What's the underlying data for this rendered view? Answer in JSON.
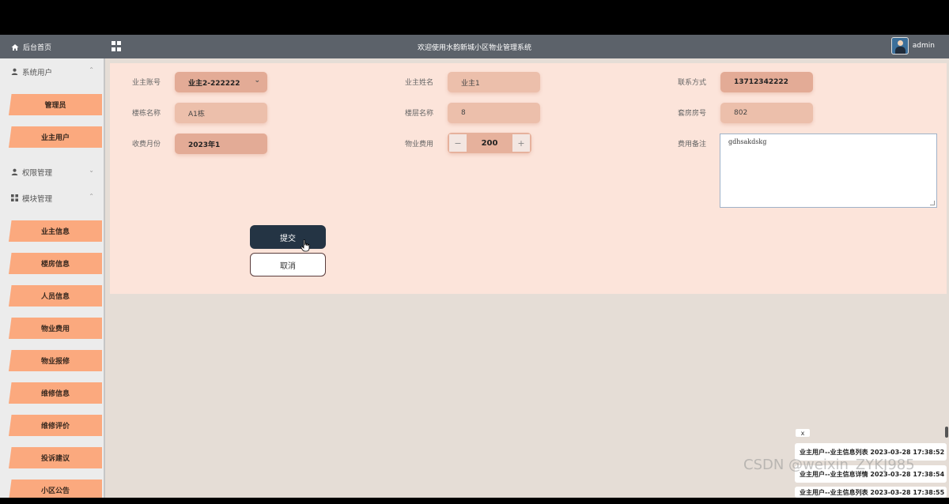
{
  "header": {
    "home_label": "后台首页",
    "title": "欢迎使用水韵新城小区物业管理系统",
    "username": "admin"
  },
  "sidebar": {
    "groups": [
      {
        "label": "系统用户",
        "icon": "user-icon",
        "chevron": "⌃"
      },
      {
        "label": "权限管理",
        "icon": "user-icon",
        "chevron": "⌄"
      },
      {
        "label": "模块管理",
        "icon": "grid-icon",
        "chevron": "⌃"
      }
    ],
    "system_items": [
      "管理员",
      "业主用户"
    ],
    "module_items": [
      "业主信息",
      "楼房信息",
      "人员信息",
      "物业费用",
      "物业报修",
      "维修信息",
      "维修评价",
      "投诉建议",
      "小区公告"
    ]
  },
  "form": {
    "owner_account_label": "业主账号",
    "owner_account_value": "业主2-222222",
    "owner_name_label": "业主姓名",
    "owner_name_value": "业主1",
    "contact_label": "联系方式",
    "contact_value": "13712342222",
    "building_label": "楼栋名称",
    "building_value": "A1栋",
    "floor_label": "楼层名称",
    "floor_value": "8",
    "room_label": "套房房号",
    "room_value": "802",
    "month_label": "收费月份",
    "month_value": "2023年1",
    "fee_label": "物业费用",
    "fee_value": "200",
    "fee_decrement": "−",
    "fee_increment": "+",
    "remark_label": "费用备注",
    "remark_value": "gdhsakdskg",
    "submit_label": "提交",
    "cancel_label": "取消"
  },
  "notifications": {
    "close_label": "x",
    "items": [
      "业主用户--业主信息列表 2023-03-28 17:38:52",
      "业主用户--业主信息详情 2023-03-28 17:38:54",
      "业主用户--业主信息列表 2023-03-28 17:38:55"
    ]
  },
  "watermark": "CSDN @weixin_ZYKJ985"
}
